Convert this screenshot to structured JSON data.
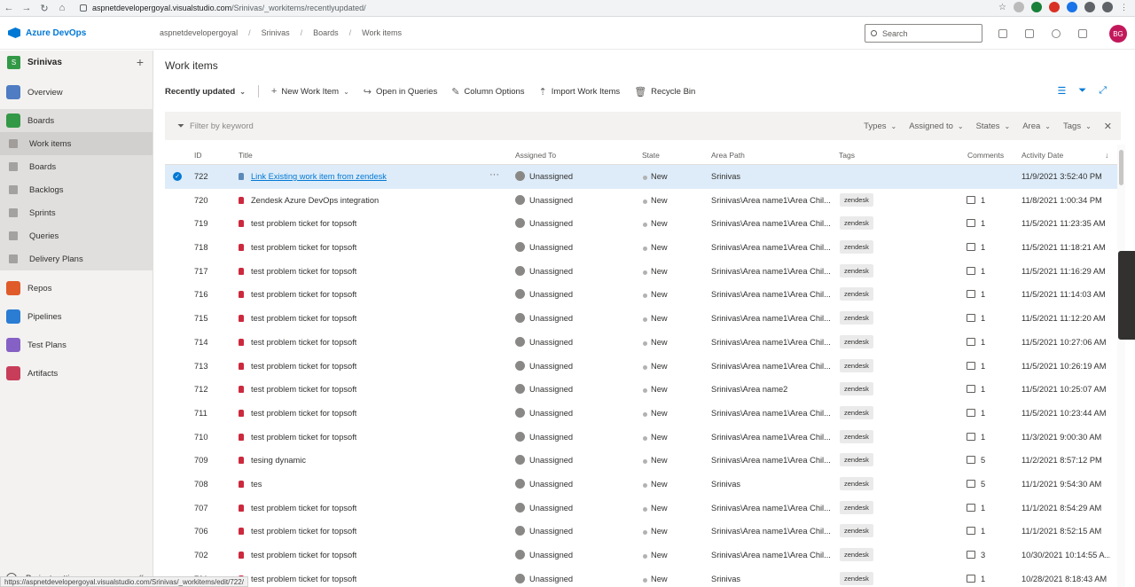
{
  "browser": {
    "url_domain": "aspnetdevelopergoyal.visualstudio.com",
    "url_path": "/Srinivas/_workitems/recentlyupdated/",
    "status_url": "https://aspnetdevelopergoyal.visualstudio.com/Srinivas/_workitems/edit/722/"
  },
  "header": {
    "brand": "Azure DevOps",
    "breadcrumbs": [
      "aspnetdevelopergoyal",
      "Srinivas",
      "Boards",
      "Work items"
    ],
    "search_placeholder": "Search",
    "avatar_initials": "BG"
  },
  "sidebar": {
    "project_initial": "S",
    "project_name": "Srinivas",
    "items": [
      {
        "label": "Overview",
        "type": "section"
      },
      {
        "label": "Boards",
        "type": "section"
      },
      {
        "label": "Work items",
        "type": "sub"
      },
      {
        "label": "Boards",
        "type": "sub"
      },
      {
        "label": "Backlogs",
        "type": "sub"
      },
      {
        "label": "Sprints",
        "type": "sub"
      },
      {
        "label": "Queries",
        "type": "sub"
      },
      {
        "label": "Delivery Plans",
        "type": "sub"
      },
      {
        "label": "Repos",
        "type": "section"
      },
      {
        "label": "Pipelines",
        "type": "section"
      },
      {
        "label": "Test Plans",
        "type": "section"
      },
      {
        "label": "Artifacts",
        "type": "section"
      }
    ],
    "settings_label": "Project settings"
  },
  "main": {
    "title": "Work items",
    "toolbar": {
      "view": "Recently updated",
      "new_item": "New Work Item",
      "open_queries": "Open in Queries",
      "column_options": "Column Options",
      "import": "Import Work Items",
      "recycle": "Recycle Bin"
    },
    "filter": {
      "placeholder": "Filter by keyword",
      "types": "Types",
      "assigned": "Assigned to",
      "states": "States",
      "area": "Area",
      "tags": "Tags"
    },
    "columns": {
      "id": "ID",
      "title": "Title",
      "assigned": "Assigned To",
      "state": "State",
      "area": "Area Path",
      "tags": "Tags",
      "comments": "Comments",
      "activity": "Activity Date"
    },
    "rows": [
      {
        "id": "722",
        "title": "Link Existing work item from zendesk",
        "assigned": "Unassigned",
        "state": "New",
        "area": "Srinivas",
        "tag": "",
        "comments": "",
        "date": "11/9/2021 3:52:40 PM"
      },
      {
        "id": "720",
        "title": "Zendesk Azure DevOps integration",
        "assigned": "Unassigned",
        "state": "New",
        "area": "Srinivas\\Area name1\\Area Chil...",
        "tag": "zendesk",
        "comments": "1",
        "date": "11/8/2021 1:00:34 PM"
      },
      {
        "id": "719",
        "title": "test problem ticket for topsoft",
        "assigned": "Unassigned",
        "state": "New",
        "area": "Srinivas\\Area name1\\Area Chil...",
        "tag": "zendesk",
        "comments": "1",
        "date": "11/5/2021 11:23:35 AM"
      },
      {
        "id": "718",
        "title": "test problem ticket for topsoft",
        "assigned": "Unassigned",
        "state": "New",
        "area": "Srinivas\\Area name1\\Area Chil...",
        "tag": "zendesk",
        "comments": "1",
        "date": "11/5/2021 11:18:21 AM"
      },
      {
        "id": "717",
        "title": "test problem ticket for topsoft",
        "assigned": "Unassigned",
        "state": "New",
        "area": "Srinivas\\Area name1\\Area Chil...",
        "tag": "zendesk",
        "comments": "1",
        "date": "11/5/2021 11:16:29 AM"
      },
      {
        "id": "716",
        "title": "test problem ticket for topsoft",
        "assigned": "Unassigned",
        "state": "New",
        "area": "Srinivas\\Area name1\\Area Chil...",
        "tag": "zendesk",
        "comments": "1",
        "date": "11/5/2021 11:14:03 AM"
      },
      {
        "id": "715",
        "title": "test problem ticket for topsoft",
        "assigned": "Unassigned",
        "state": "New",
        "area": "Srinivas\\Area name1\\Area Chil...",
        "tag": "zendesk",
        "comments": "1",
        "date": "11/5/2021 11:12:20 AM"
      },
      {
        "id": "714",
        "title": "test problem ticket for topsoft",
        "assigned": "Unassigned",
        "state": "New",
        "area": "Srinivas\\Area name1\\Area Chil...",
        "tag": "zendesk",
        "comments": "1",
        "date": "11/5/2021 10:27:06 AM"
      },
      {
        "id": "713",
        "title": "test problem ticket for topsoft",
        "assigned": "Unassigned",
        "state": "New",
        "area": "Srinivas\\Area name1\\Area Chil...",
        "tag": "zendesk",
        "comments": "1",
        "date": "11/5/2021 10:26:19 AM"
      },
      {
        "id": "712",
        "title": "test problem ticket for topsoft",
        "assigned": "Unassigned",
        "state": "New",
        "area": "Srinivas\\Area name2",
        "tag": "zendesk",
        "comments": "1",
        "date": "11/5/2021 10:25:07 AM"
      },
      {
        "id": "711",
        "title": "test problem ticket for topsoft",
        "assigned": "Unassigned",
        "state": "New",
        "area": "Srinivas\\Area name1\\Area Chil...",
        "tag": "zendesk",
        "comments": "1",
        "date": "11/5/2021 10:23:44 AM"
      },
      {
        "id": "710",
        "title": "test problem ticket for topsoft",
        "assigned": "Unassigned",
        "state": "New",
        "area": "Srinivas\\Area name1\\Area Chil...",
        "tag": "zendesk",
        "comments": "1",
        "date": "11/3/2021 9:00:30 AM"
      },
      {
        "id": "709",
        "title": "tesing dynamic",
        "assigned": "Unassigned",
        "state": "New",
        "area": "Srinivas\\Area name1\\Area Chil...",
        "tag": "zendesk",
        "comments": "5",
        "date": "11/2/2021 8:57:12 PM"
      },
      {
        "id": "708",
        "title": "tes",
        "assigned": "Unassigned",
        "state": "New",
        "area": "Srinivas",
        "tag": "zendesk",
        "comments": "5",
        "date": "11/1/2021 9:54:30 AM"
      },
      {
        "id": "707",
        "title": "test problem ticket for topsoft",
        "assigned": "Unassigned",
        "state": "New",
        "area": "Srinivas\\Area name1\\Area Chil...",
        "tag": "zendesk",
        "comments": "1",
        "date": "11/1/2021 8:54:29 AM"
      },
      {
        "id": "706",
        "title": "test problem ticket for topsoft",
        "assigned": "Unassigned",
        "state": "New",
        "area": "Srinivas\\Area name1\\Area Chil...",
        "tag": "zendesk",
        "comments": "1",
        "date": "11/1/2021 8:52:15 AM"
      },
      {
        "id": "702",
        "title": "test problem ticket for topsoft",
        "assigned": "Unassigned",
        "state": "New",
        "area": "Srinivas\\Area name1\\Area Chil...",
        "tag": "zendesk",
        "comments": "3",
        "date": "10/30/2021 10:14:55 A..."
      },
      {
        "id": "701",
        "title": "test problem ticket for topsoft",
        "assigned": "Unassigned",
        "state": "New",
        "area": "Srinivas",
        "tag": "zendesk",
        "comments": "1",
        "date": "10/28/2021 8:18:43 AM"
      }
    ]
  },
  "colors": {
    "accent": "#0078d4",
    "selected_row": "#deecf9",
    "bug_icon": "#cc293d",
    "issue_icon": "#5c8ab8"
  },
  "icons": {
    "sidebar": [
      "overview-icon",
      "boards-icon",
      "work-items-icon",
      "boards-sub-icon",
      "backlogs-icon",
      "sprints-icon",
      "queries-icon",
      "delivery-plans-icon",
      "repos-icon",
      "pipelines-icon",
      "test-plans-icon",
      "artifacts-icon"
    ]
  }
}
